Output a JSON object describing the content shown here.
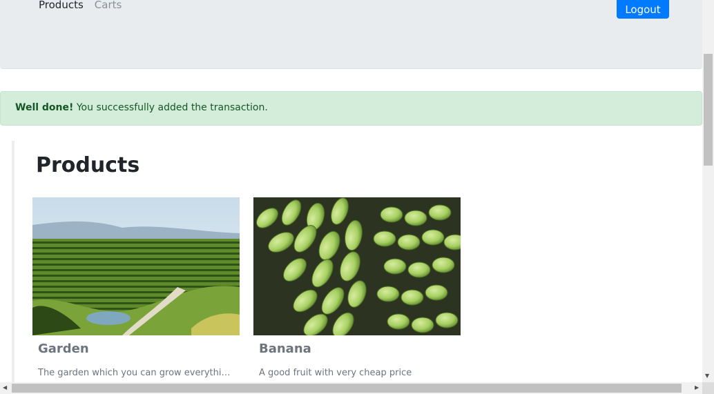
{
  "navbar": {
    "links": [
      {
        "label": "Products"
      },
      {
        "label": "Carts"
      }
    ],
    "logout_label": "Logout"
  },
  "alert": {
    "strong": "Well done!",
    "message": " You successfully added the transaction."
  },
  "page": {
    "title": "Products"
  },
  "products": [
    {
      "title": "Garden",
      "description": "The garden which you can grow everything you want",
      "image": "garden-photo"
    },
    {
      "title": "Banana",
      "description": "A good fruit with very cheap price",
      "image": "banana-photo"
    }
  ],
  "colors": {
    "navbar_bg": "#e9ecef",
    "primary": "#007bff",
    "success_bg": "#d4edda",
    "success_text": "#155724"
  }
}
